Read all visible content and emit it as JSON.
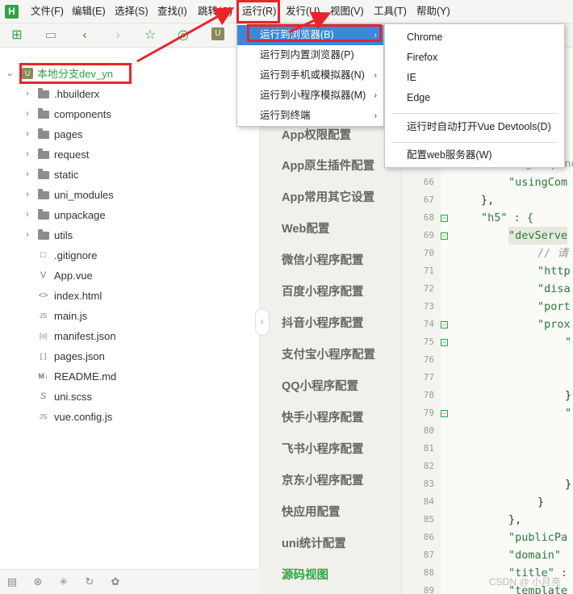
{
  "menubar": {
    "items": [
      {
        "label": "文件(F)"
      },
      {
        "label": "编辑(E)"
      },
      {
        "label": "选择(S)"
      },
      {
        "label": "查找(I)"
      },
      {
        "label": "跳转(G)"
      },
      {
        "label": "运行(R)"
      },
      {
        "label": "发行(U)"
      },
      {
        "label": "视图(V)"
      },
      {
        "label": "工具(T)"
      },
      {
        "label": "帮助(Y)"
      }
    ],
    "logo": "H"
  },
  "toolbar": {
    "tab_icon": "U"
  },
  "run_menu": {
    "items": [
      {
        "label": "运行到浏览器(B)"
      },
      {
        "label": "运行到内置浏览器(P)"
      },
      {
        "label": "运行到手机或模拟器(N)"
      },
      {
        "label": "运行到小程序模拟器(M)"
      },
      {
        "label": "运行到终端"
      }
    ],
    "submenu_arrow": "›"
  },
  "browser_menu": {
    "items": [
      {
        "label": "Chrome"
      },
      {
        "label": "Firefox"
      },
      {
        "label": "IE"
      },
      {
        "label": "Edge"
      },
      {
        "label": "运行时自动打开Vue Devtools(D)"
      },
      {
        "label": "配置web服务器(W)"
      }
    ]
  },
  "project_tree": {
    "root": {
      "label": "本地分支dev_yn",
      "icon": "U"
    },
    "folders": [
      {
        "label": ".hbuilderx"
      },
      {
        "label": "components"
      },
      {
        "label": "pages"
      },
      {
        "label": "request"
      },
      {
        "label": "static"
      },
      {
        "label": "uni_modules"
      },
      {
        "label": "unpackage"
      },
      {
        "label": "utils"
      }
    ],
    "files": [
      {
        "label": ".gitignore",
        "icon": "□"
      },
      {
        "label": "App.vue",
        "icon": "V"
      },
      {
        "label": "index.html",
        "icon": "<>"
      },
      {
        "label": "main.js",
        "icon": "JS"
      },
      {
        "label": "manifest.json",
        "icon": "[o]"
      },
      {
        "label": "pages.json",
        "icon": "[ ]"
      },
      {
        "label": "README.md",
        "icon": "M↓"
      },
      {
        "label": "uni.scss",
        "icon": "S"
      },
      {
        "label": "vue.config.js",
        "icon": "JS"
      }
    ]
  },
  "settings_nav": {
    "items": [
      {
        "label": "App权限配置"
      },
      {
        "label": "App原生插件配置"
      },
      {
        "label": "App常用其它设置"
      },
      {
        "label": "Web配置"
      },
      {
        "label": "微信小程序配置"
      },
      {
        "label": "百度小程序配置"
      },
      {
        "label": "抖音小程序配置"
      },
      {
        "label": "支付宝小程序配置"
      },
      {
        "label": "QQ小程序配置"
      },
      {
        "label": "快手小程序配置"
      },
      {
        "label": "飞书小程序配置"
      },
      {
        "label": "京东小程序配置"
      },
      {
        "label": "快应用配置"
      },
      {
        "label": "uni统计配置"
      },
      {
        "label": "源码视图"
      }
    ],
    "collapse_icon": "‹"
  },
  "editor": {
    "partial_top": "\"usingComponents\"",
    "lines": [
      {
        "n": "66",
        "text": "\"usingCom"
      },
      {
        "n": "67",
        "text": "},"
      },
      {
        "n": "68",
        "text": "\"h5\" : {"
      },
      {
        "n": "69",
        "text": "\"devServe"
      },
      {
        "n": "70",
        "text": "// 请"
      },
      {
        "n": "71",
        "text": "\"http"
      },
      {
        "n": "72",
        "text": "\"disa"
      },
      {
        "n": "73",
        "text": "\"port"
      },
      {
        "n": "74",
        "text": "\"prox"
      },
      {
        "n": "75",
        "text": "\""
      },
      {
        "n": "76",
        "text": ""
      },
      {
        "n": "77",
        "text": ""
      },
      {
        "n": "78",
        "text": "}"
      },
      {
        "n": "79",
        "text": "\""
      },
      {
        "n": "80",
        "text": ""
      },
      {
        "n": "81",
        "text": ""
      },
      {
        "n": "82",
        "text": ""
      },
      {
        "n": "83",
        "text": "}"
      },
      {
        "n": "84",
        "text": "}"
      },
      {
        "n": "85",
        "text": "},"
      },
      {
        "n": "86",
        "text": "\"publicPa"
      },
      {
        "n": "87",
        "text": "\"domain\""
      },
      {
        "n": "88",
        "text": "\"title\" :"
      },
      {
        "n": "89",
        "text": "\"template"
      }
    ]
  },
  "watermark": "CSDN @ 小月亮",
  "colors": {
    "accent": "#2fa343",
    "highlight": "#e8242c",
    "selection": "#3b88d8"
  }
}
